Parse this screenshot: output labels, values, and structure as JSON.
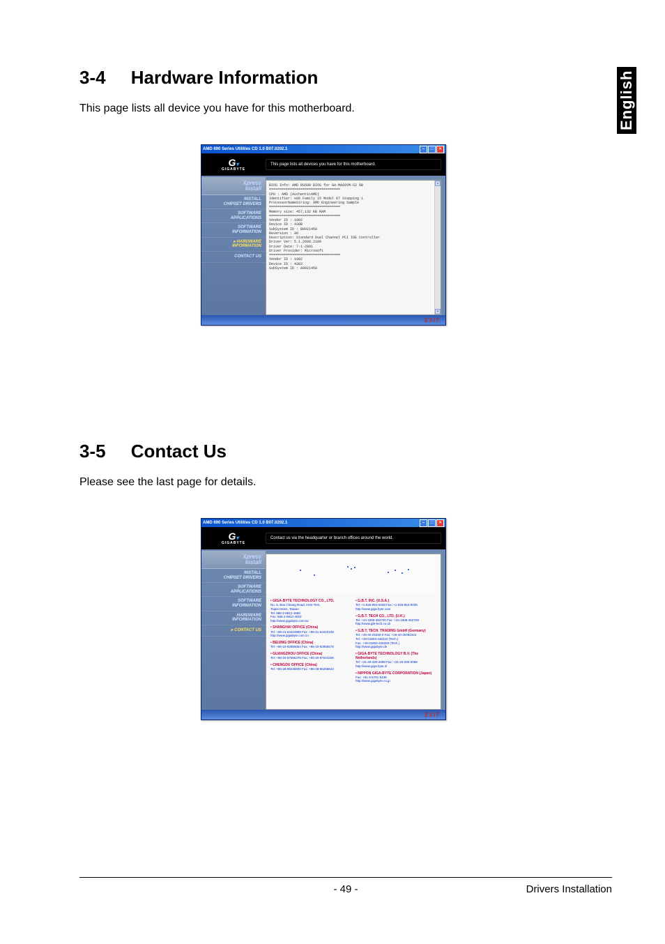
{
  "side_tab": "English",
  "section1": {
    "number": "3-4",
    "title": "Hardware Information",
    "body": "This page lists all device you have for this motherboard."
  },
  "section2": {
    "number": "3-5",
    "title": "Contact Us",
    "body": "Please see the last page for details."
  },
  "app_title": "AMD 690 Series Utilities CD 1.0 B07.0202.1",
  "brand": "GIGABYTE",
  "sidebar": {
    "xpress_line1": "Xpress",
    "xpress_line2": "Install",
    "items": [
      {
        "line1": "INSTALL",
        "line2": "CHIPSET DRIVERS"
      },
      {
        "line1": "SOFTWARE",
        "line2": "APPLICATIONS"
      },
      {
        "line1": "SOFTWARE",
        "line2": "INFORMATION"
      },
      {
        "line1": "HARDWARE",
        "line2": "INFORMATION"
      },
      {
        "line1": "CONTACT US",
        "line2": ""
      }
    ]
  },
  "win1": {
    "banner_msg": "This page lists all devices you have for this motherboard.",
    "lines": [
      "BIOS Info: AMD RS690 BIOS for GA-MA69VM-S2 DB",
      "==================================",
      "CPU : AMD (AuthenticAMD)",
      "Identifier: x86 Family 15 Model 67 Stepping 1",
      "ProcessorNameString: AMD Engineering Sample",
      "==================================",
      "Memory size: 457,132  KB RAM",
      "==================================",
      "Vendor ID : 1002",
      "Device ID : 438B",
      "SubSystem ID : B0021458",
      "Reversion : 00",
      "Description: Standard Dual Channel PCI IDE Controller",
      "Driver Ver: 5.1.2600.2180",
      "Driver Date: 7-1-2001",
      "Driver Provider: Microsoft",
      "==================================",
      "Vendor ID : 1002",
      "Device ID : 4383",
      "SubSystem ID : A0021458"
    ]
  },
  "win2": {
    "banner_msg": "Contact us via the headquarter or branch offices around the world.",
    "left": [
      {
        "name": "GIGA-BYTE TECHNOLOGY CO., LTD.",
        "lines": [
          "No. 6, Bau Chiang Road, Hsin-Tien,",
          "Taipei Hsien, Taiwan",
          "Tel: 886-2-8912-4888",
          "Fax: 886-2-8912-4003",
          "http://www.gigabyte.com.tw"
        ]
      },
      {
        "name": "SHANGHAI OFFICE (China)",
        "lines": [
          "Tel: +86-21-63410999  Fax: +86-21-63410100",
          "http://www.gigabyte.com.cn"
        ]
      },
      {
        "name": "BEIJING OFFICE (China)",
        "lines": [
          "Tel: +86-10-82856054  Fax: +86-10-82856575"
        ]
      },
      {
        "name": "GUANGZHOU OFFICE (China)",
        "lines": [
          "Tel: +86-20-87586375  Fax: +86-20-87544306"
        ]
      },
      {
        "name": "CHENGDU OFFICE (China)",
        "lines": [
          "Tel: +86-28-85236930  Fax: +86-28-85256822"
        ]
      }
    ],
    "right": [
      {
        "name": "G.B.T. INC. (U.S.A.)",
        "lines": [
          "Tel: +1-626-854-9338  Fax: +1-626-854-9339",
          "http://www.giga-byte.com"
        ]
      },
      {
        "name": "G.B.T. TECH CO., LTD. (U.K.)",
        "lines": [
          "Tel: +44-1908-362700  Fax: +44-1908-362709",
          "http://www.gbt-tech.co.uk"
        ]
      },
      {
        "name": "G.B.T. TECH. TRADING GmbH (Germany)",
        "lines": [
          "Tel: +49-40-25330-0  Fax: +49-40-25492343",
          "Tel: +49-01803-446222 (Tech.)",
          "Fax: +49-01803-428329 (Tech.)",
          "http://www.gigabyte.de"
        ]
      },
      {
        "name": "GIGA-BYTE TECHNOLOGY B.V. (The Netherlands)",
        "lines": [
          "Tel: +31-40-290-2088  Fax: +31-40-290-2089",
          "http://www.giga-byte.nl"
        ]
      },
      {
        "name": "NIPPON GIGA-BYTE CORPORATION (Japan)",
        "lines": [
          "Fax: +81-3-5791-5439",
          "http://www.gigabyte.co.jp"
        ]
      }
    ]
  },
  "exit_label": "EXIT",
  "footer": {
    "page_number": "- 49 -",
    "right_label": "Drivers Installation"
  }
}
